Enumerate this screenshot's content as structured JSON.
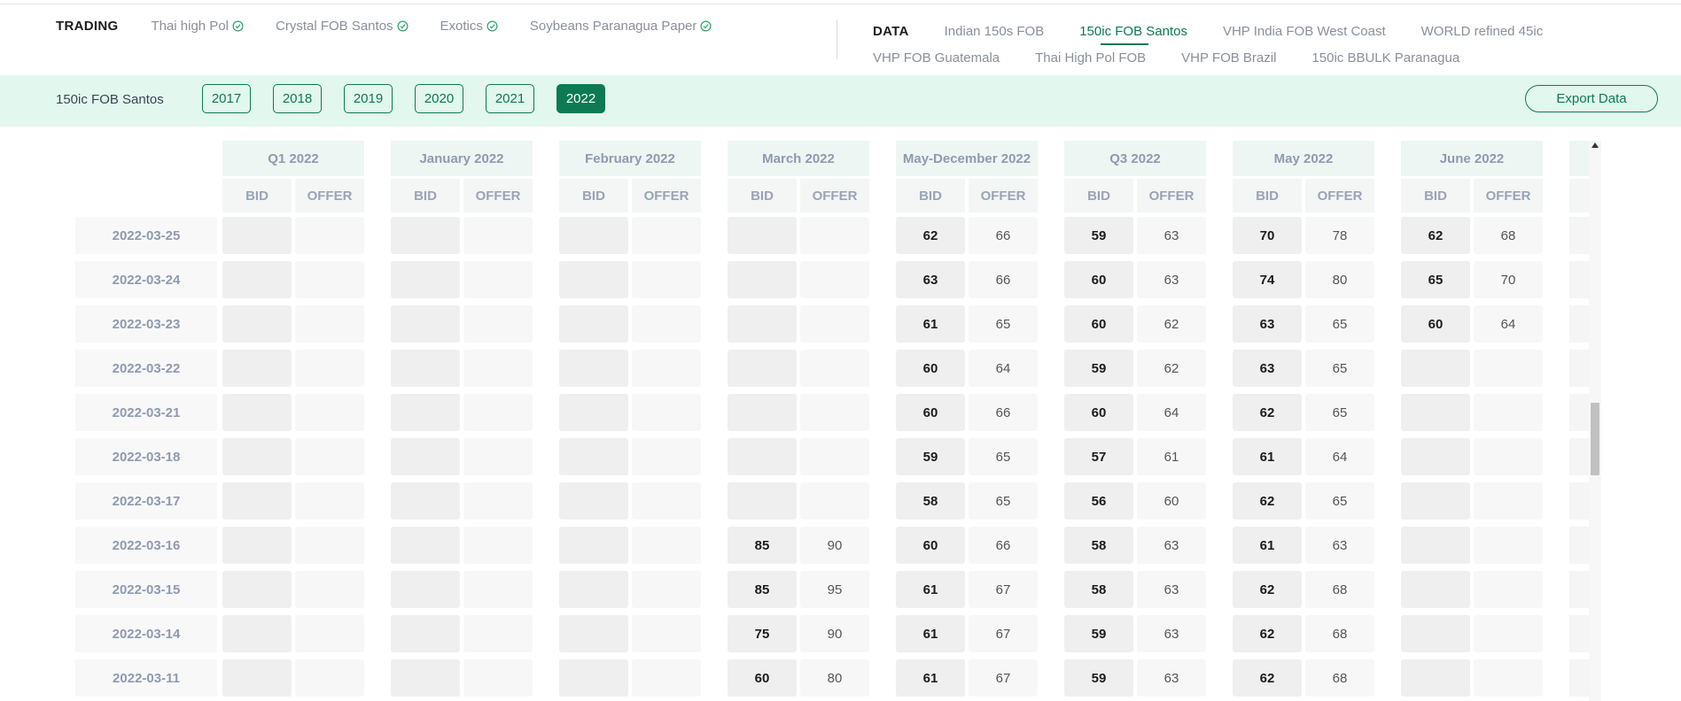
{
  "nav": {
    "trading_heading": "TRADING",
    "trading_links": [
      {
        "label": "Thai high Pol",
        "icon": "check-circle-icon"
      },
      {
        "label": "Crystal FOB Santos",
        "icon": "check-circle-icon"
      },
      {
        "label": "Exotics",
        "icon": "check-circle-icon"
      },
      {
        "label": "Soybeans Paranagua Paper",
        "icon": "check-circle-icon"
      }
    ],
    "data_heading": "DATA",
    "data_links_row1": [
      "Indian 150s FOB",
      "150ic FOB Santos",
      "VHP India FOB West Coast",
      "WORLD refined 45ic"
    ],
    "data_links_row2": [
      "VHP FOB Guatemala",
      "Thai High Pol FOB",
      "VHP FOB Brazil",
      "150ic BBULK Paranagua"
    ],
    "active_link": "150ic FOB Santos"
  },
  "yearbar": {
    "label": "150ic FOB Santos",
    "years": [
      "2017",
      "2018",
      "2019",
      "2020",
      "2021",
      "2022"
    ],
    "active_year": "2022",
    "export_label": "Export Data"
  },
  "colors": {
    "accent": "#0c7a53",
    "bar_bg": "#e2f7ee"
  },
  "table": {
    "bid_label": "BID",
    "offer_label": "OFFER",
    "dates": [
      "2022-03-25",
      "2022-03-24",
      "2022-03-23",
      "2022-03-22",
      "2022-03-21",
      "2022-03-18",
      "2022-03-17",
      "2022-03-16",
      "2022-03-15",
      "2022-03-14",
      "2022-03-11"
    ],
    "columns": [
      {
        "title": "Q1 2022",
        "bids": [
          "",
          "",
          "",
          "",
          "",
          "",
          "",
          "",
          "",
          "",
          ""
        ],
        "offers": [
          "",
          "",
          "",
          "",
          "",
          "",
          "",
          "",
          "",
          "",
          ""
        ]
      },
      {
        "title": "January 2022",
        "bids": [
          "",
          "",
          "",
          "",
          "",
          "",
          "",
          "",
          "",
          "",
          ""
        ],
        "offers": [
          "",
          "",
          "",
          "",
          "",
          "",
          "",
          "",
          "",
          "",
          ""
        ]
      },
      {
        "title": "February 2022",
        "bids": [
          "",
          "",
          "",
          "",
          "",
          "",
          "",
          "",
          "",
          "",
          ""
        ],
        "offers": [
          "",
          "",
          "",
          "",
          "",
          "",
          "",
          "",
          "",
          "",
          ""
        ]
      },
      {
        "title": "March 2022",
        "bids": [
          "",
          "",
          "",
          "",
          "",
          "",
          "",
          "85",
          "85",
          "75",
          "60"
        ],
        "offers": [
          "",
          "",
          "",
          "",
          "",
          "",
          "",
          "90",
          "95",
          "90",
          "80"
        ]
      },
      {
        "title": "May-December 2022",
        "bids": [
          "62",
          "63",
          "61",
          "60",
          "60",
          "59",
          "58",
          "60",
          "61",
          "61",
          "61"
        ],
        "offers": [
          "66",
          "66",
          "65",
          "64",
          "66",
          "65",
          "65",
          "66",
          "67",
          "67",
          "67"
        ]
      },
      {
        "title": "Q3 2022",
        "bids": [
          "59",
          "60",
          "60",
          "59",
          "60",
          "57",
          "56",
          "58",
          "58",
          "59",
          "59"
        ],
        "offers": [
          "63",
          "63",
          "62",
          "62",
          "64",
          "61",
          "60",
          "63",
          "63",
          "63",
          "63"
        ]
      },
      {
        "title": "May 2022",
        "bids": [
          "70",
          "74",
          "63",
          "63",
          "62",
          "61",
          "62",
          "61",
          "62",
          "62",
          "62"
        ],
        "offers": [
          "78",
          "80",
          "65",
          "65",
          "65",
          "64",
          "65",
          "63",
          "68",
          "68",
          "68"
        ]
      },
      {
        "title": "June 2022",
        "bids": [
          "62",
          "65",
          "60",
          "",
          "",
          "",
          "",
          "",
          "",
          "",
          ""
        ],
        "offers": [
          "68",
          "70",
          "64",
          "",
          "",
          "",
          "",
          "",
          "",
          "",
          ""
        ]
      }
    ]
  }
}
